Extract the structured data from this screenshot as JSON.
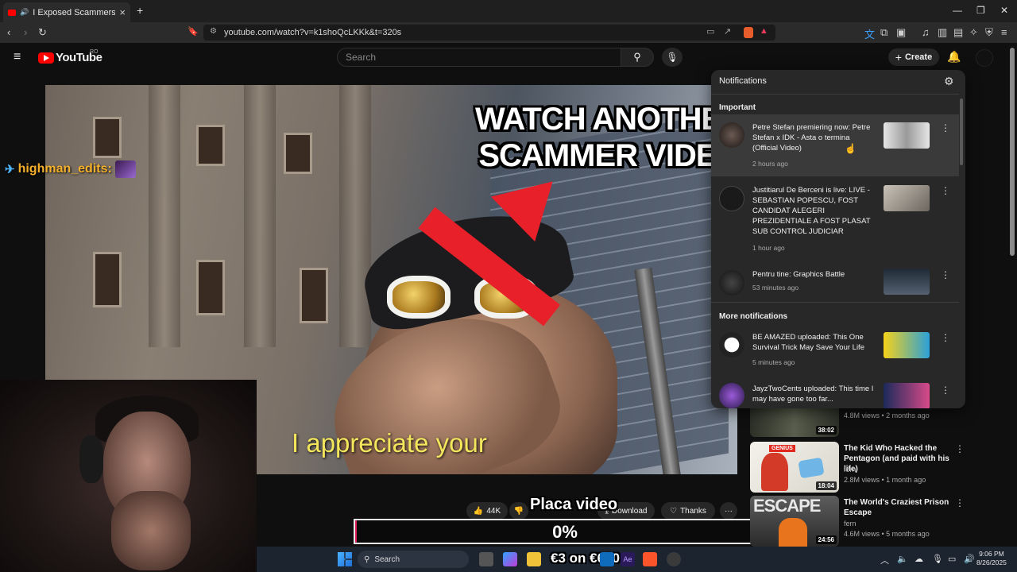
{
  "browser": {
    "tab_title": "I Exposed Scammers in NYC!",
    "tab_close": "×",
    "new_tab": "+",
    "url": "youtube.com/watch?v=k1shoQcLKKk&t=320s",
    "window_controls": {
      "minimize": "—",
      "restore": "❐",
      "close": "✕"
    }
  },
  "youtube": {
    "logo_text": "YouTube",
    "region": "RO",
    "search_placeholder": "Search",
    "create_label": "Create"
  },
  "video": {
    "overlay_line1": "WATCH ANOTHER",
    "overlay_line2": "SCAMMER VIDEO",
    "caption": "I appreciate your"
  },
  "stream_overlay": {
    "chat_user": "highman_edits:",
    "place_video_label": "Placa video",
    "progress_percent": 0,
    "progress_label": "0%",
    "price_label": "€3 on €600"
  },
  "actions": {
    "like_count": "44K",
    "download_label": "Download",
    "thanks_label": "Thanks",
    "more_label": "···"
  },
  "notifications": {
    "title": "Notifications",
    "important_label": "Important",
    "more_label": "More notifications",
    "items": [
      {
        "text": "Petre Stefan premiering now: Petre Stefan x IDK - Asta o termina (Official Video)",
        "time": "2 hours ago"
      },
      {
        "text": "Justitiarul De Berceni is live: LIVE - SEBASTIAN POPESCU, FOST CANDIDAT ALEGERI PREZIDENTIALE A FOST PLASAT SUB CONTROL JUDICIAR",
        "time": "1 hour ago"
      },
      {
        "text": "Pentru tine: Graphics Battle",
        "time": "53 minutes ago"
      },
      {
        "text": "BE AMAZED uploaded: This One Survival Trick May Save Your Life",
        "time": "5 minutes ago"
      },
      {
        "text": "JayzTwoCents uploaded: This time I may have gone too far...",
        "time": ""
      }
    ]
  },
  "recommendations": [
    {
      "title": "",
      "channel": "",
      "meta": "4.8M views • 2 months ago",
      "duration": "38:02"
    },
    {
      "title": "The Kid Who Hacked the Pentagon (and paid with his life)",
      "channel": "fern",
      "meta": "2.8M views • 1 month ago",
      "duration": "18:04",
      "thumb_text": "GENIUS"
    },
    {
      "title": "The World's Craziest Prison Escape",
      "channel": "fern",
      "meta": "4.6M views • 5 months ago",
      "duration": "24:56",
      "thumb_text": "ESCAPE"
    }
  ],
  "taskbar": {
    "search_label": "Search",
    "time": "9:06 PM",
    "date": "8/26/2025"
  },
  "colors": {
    "youtube_red": "#ff0000",
    "progress_accent": "#e0245e",
    "chat_name": "#f4b02a",
    "caption_yellow": "#f4e65c"
  }
}
